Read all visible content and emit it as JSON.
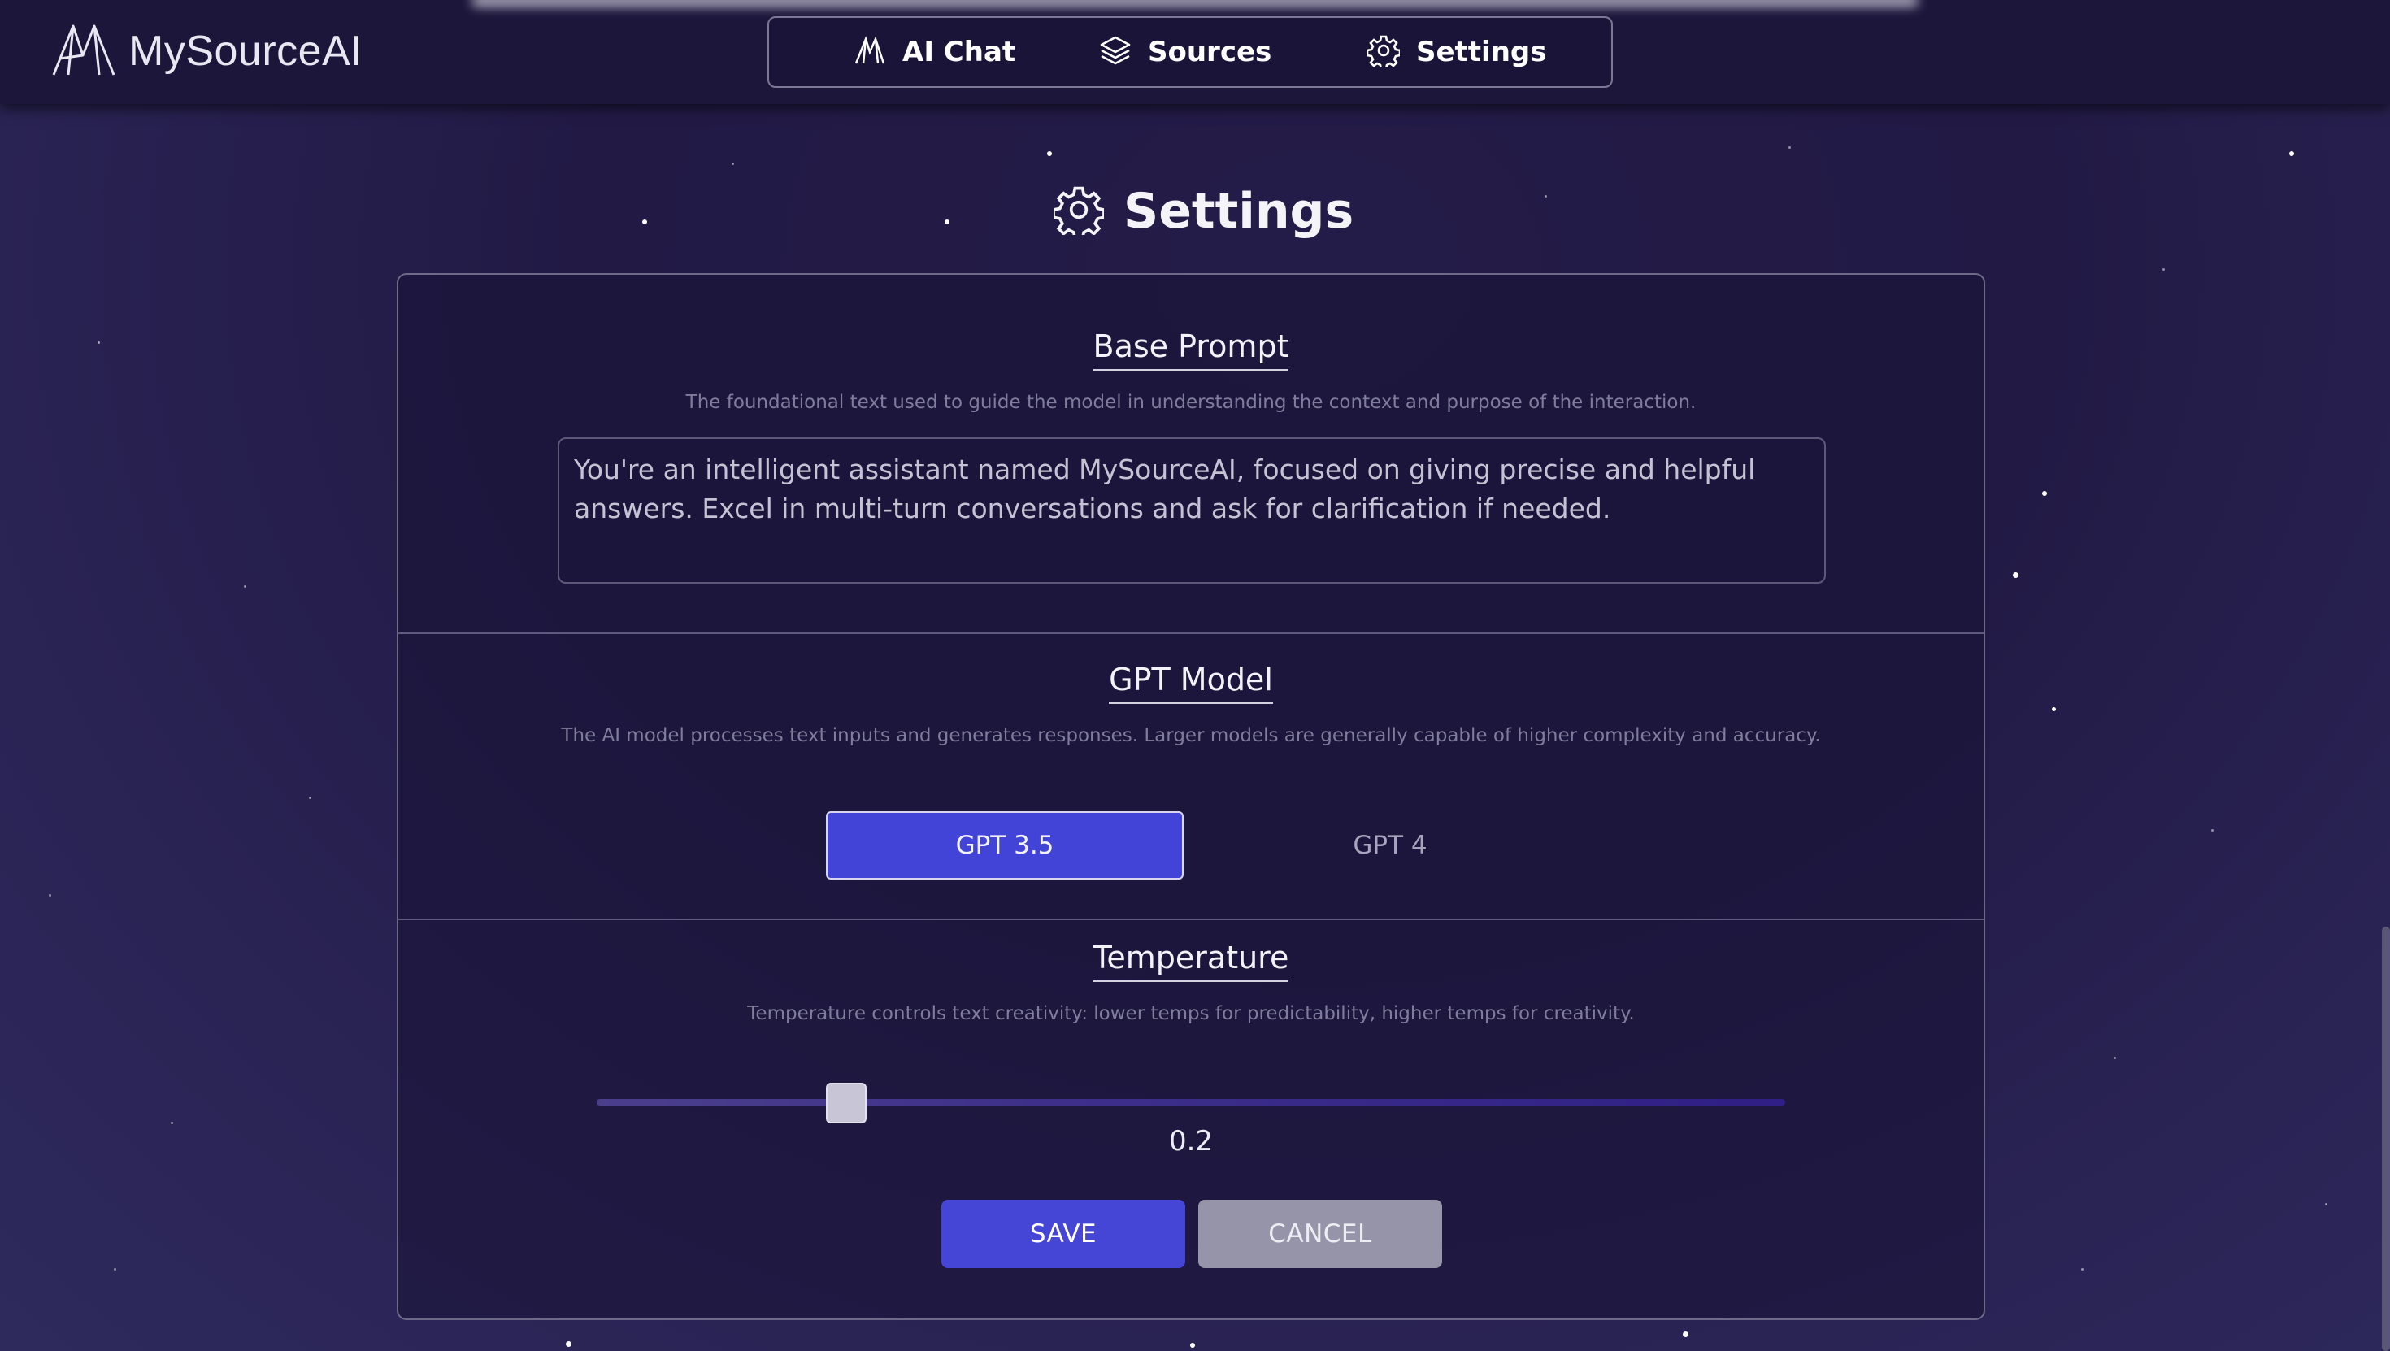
{
  "app": {
    "brand_name": "MySourceAI",
    "logo_icon": "mysourceai-logo-icon"
  },
  "nav": {
    "items": [
      {
        "label": "AI Chat",
        "icon": "ai-logo-icon"
      },
      {
        "label": "Sources",
        "icon": "layers-icon"
      },
      {
        "label": "Settings",
        "icon": "gear-icon"
      }
    ]
  },
  "page": {
    "title": "Settings",
    "title_icon": "gear-icon"
  },
  "base_prompt": {
    "title": "Base Prompt",
    "description": "The foundational text used to guide the model in understanding the context and purpose of the interaction.",
    "value": "You're an intelligent assistant named MySourceAI, focused on giving precise and helpful answers. Excel in multi-turn conversations and ask for clarification if needed."
  },
  "gpt_model": {
    "title": "GPT Model",
    "description": "The AI model processes text inputs and generates responses. Larger models are generally capable of higher complexity and accuracy.",
    "options": [
      "GPT 3.5",
      "GPT 4"
    ],
    "selected": "GPT 3.5"
  },
  "temperature": {
    "title": "Temperature",
    "description": "Temperature controls text creativity: lower temps for predictability, higher temps for creativity.",
    "value": "0.2",
    "level": 0.2
  },
  "actions": {
    "save_label": "SAVE",
    "cancel_label": "CANCEL"
  },
  "colors": {
    "background": "#221a45",
    "header": "#1b163a",
    "accent": "#4244d8",
    "cancel": "#9694a8"
  }
}
